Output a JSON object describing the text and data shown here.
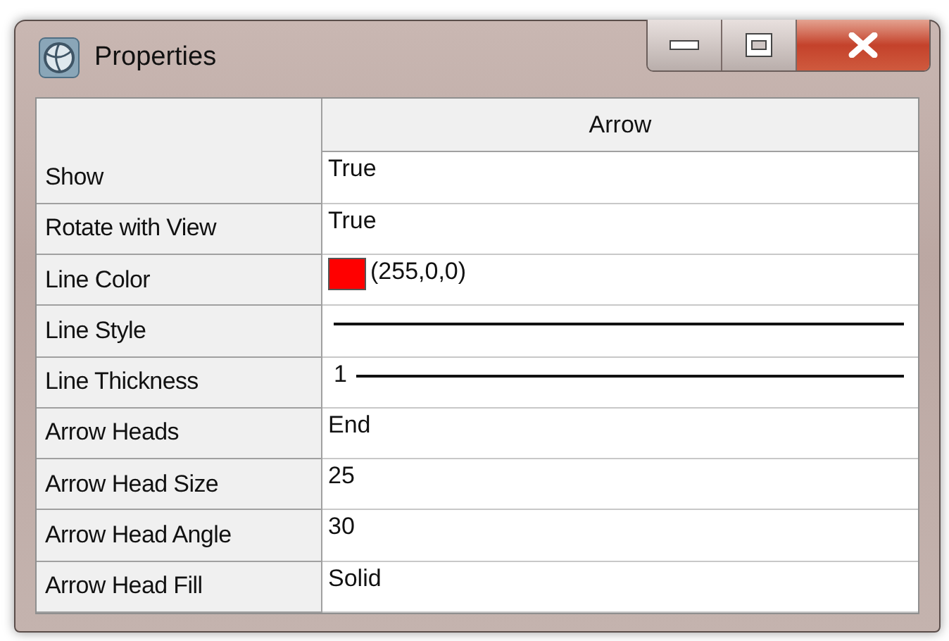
{
  "window": {
    "title": "Properties"
  },
  "grid": {
    "column_header": "Arrow",
    "rows": [
      {
        "label": "Show",
        "kind": "text",
        "value": "True"
      },
      {
        "label": "Rotate with View",
        "kind": "text",
        "value": "True"
      },
      {
        "label": "Line Color",
        "kind": "color",
        "value": "(255,0,0)",
        "color": "#ff0000"
      },
      {
        "label": "Line Style",
        "kind": "line"
      },
      {
        "label": "Line Thickness",
        "kind": "thickness",
        "value": "1"
      },
      {
        "label": "Arrow Heads",
        "kind": "text",
        "value": "End"
      },
      {
        "label": "Arrow Head Size",
        "kind": "text",
        "value": "25"
      },
      {
        "label": "Arrow Head Angle",
        "kind": "text",
        "value": "30"
      },
      {
        "label": "Arrow Head Fill",
        "kind": "text",
        "value": "Solid"
      }
    ]
  }
}
